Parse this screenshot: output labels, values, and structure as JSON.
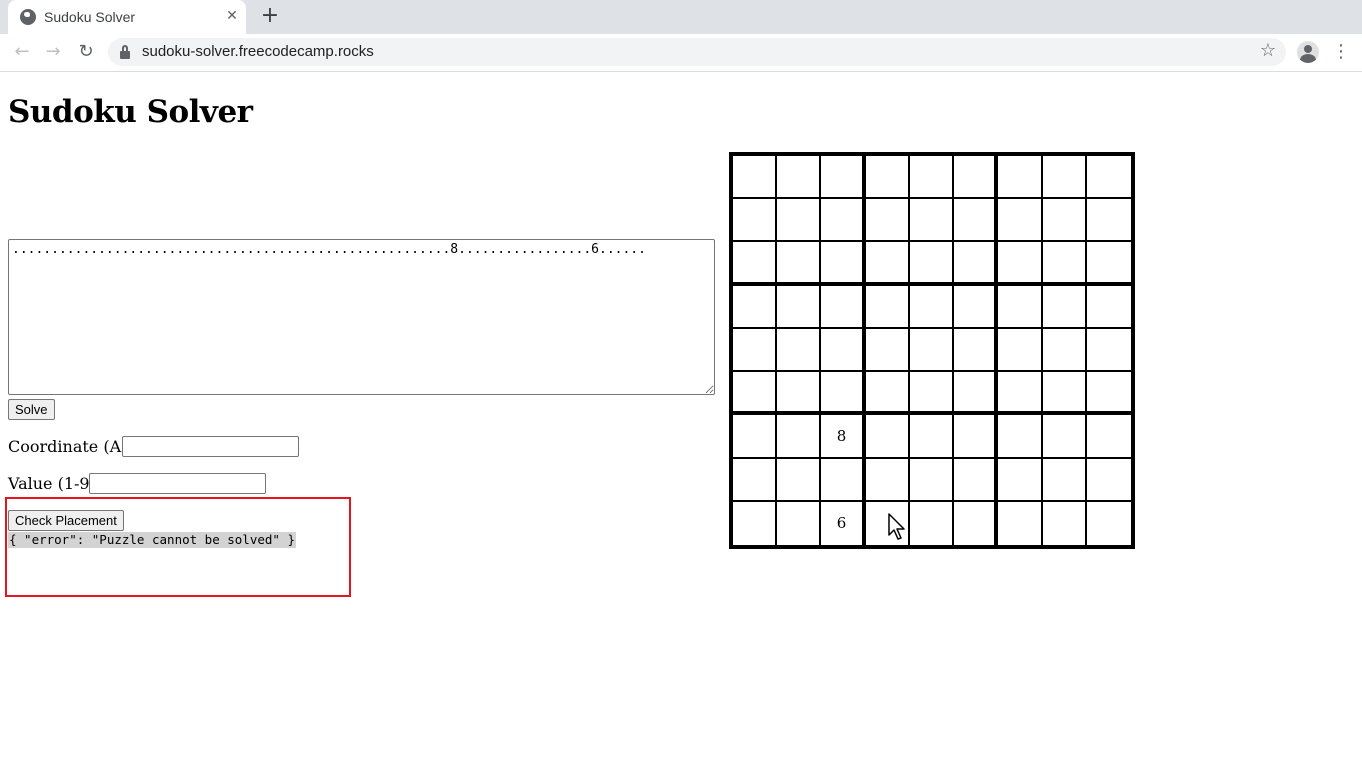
{
  "browser": {
    "tab_title": "Sudoku Solver",
    "tab_close": "✕",
    "new_tab": "+",
    "url": "sudoku-solver.freecodecamp.rocks",
    "back": "←",
    "forward": "→",
    "reload": "↻",
    "star": "☆",
    "menu": "⋮"
  },
  "page": {
    "title": "Sudoku Solver",
    "puzzle_string": "........................................................8.................6......",
    "solve_label": "Solve",
    "coordinate_label": "Coordinate (A1):",
    "coordinate_value": "",
    "value_label": "Value (1-9):",
    "value_value": "",
    "check_label": "Check Placement",
    "error_output": "{ \"error\": \"Puzzle cannot be solved\" }"
  },
  "colors": {
    "highlight_border": "#e8141c",
    "output_background": "#d3d3d3"
  }
}
